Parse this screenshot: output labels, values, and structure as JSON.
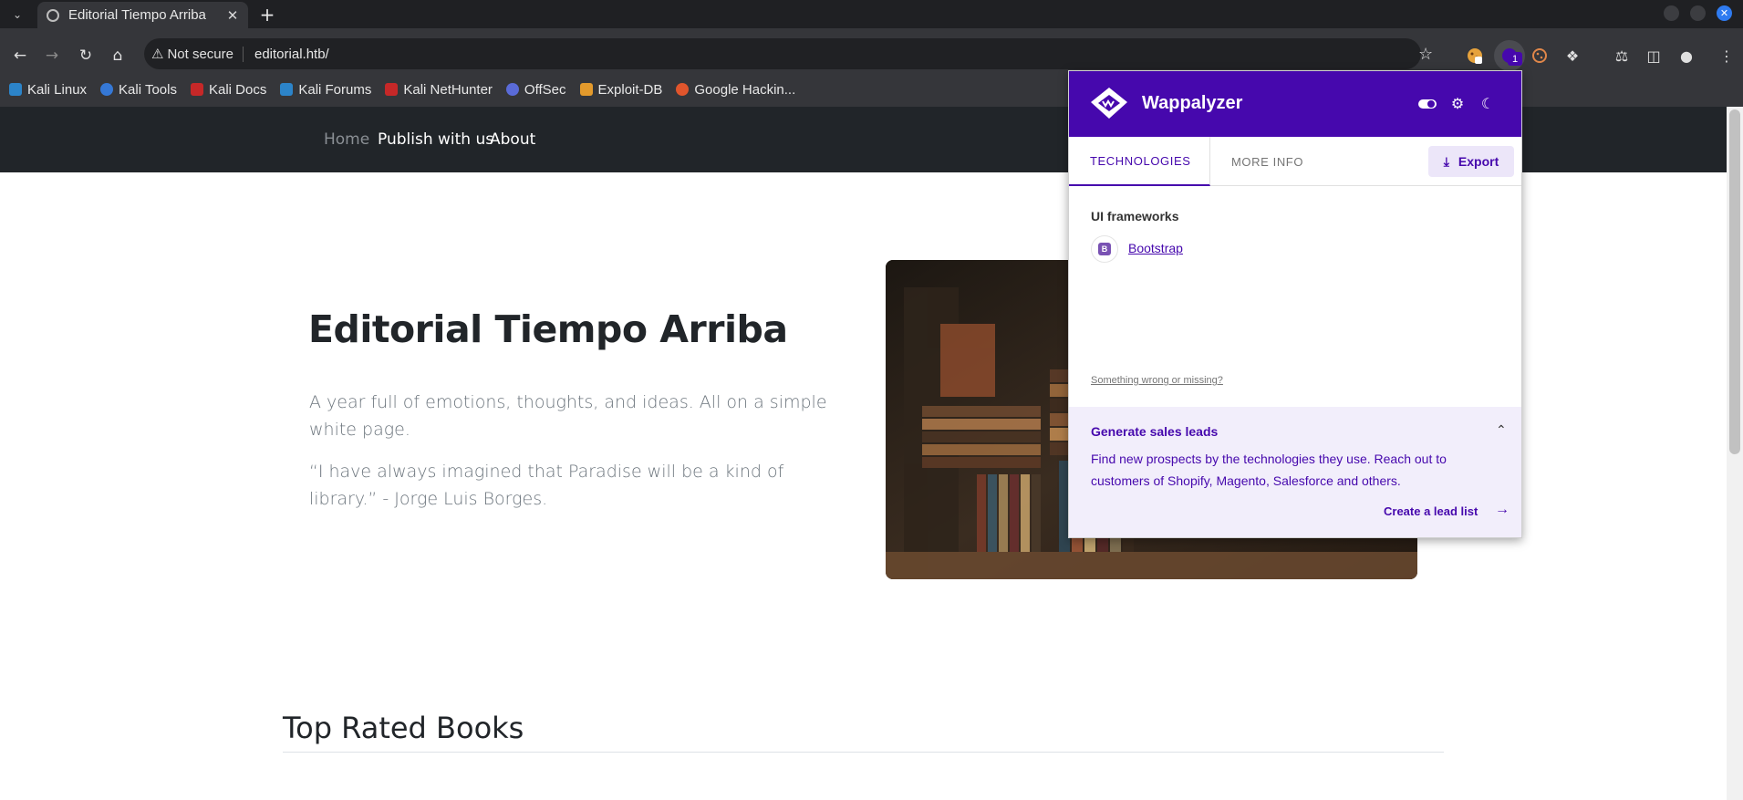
{
  "browser": {
    "tab_title": "Editorial Tiempo Arriba",
    "security_label": "Not secure",
    "url": "editorial.htb/",
    "extension_badge": "1",
    "bookmarks": [
      "Kali Linux",
      "Kali Tools",
      "Kali Docs",
      "Kali Forums",
      "Kali NetHunter",
      "OffSec",
      "Exploit-DB",
      "Google Hackin..."
    ]
  },
  "site": {
    "nav": [
      "Home",
      "Publish with us",
      "About"
    ],
    "hero_title": "Editorial Tiempo Arriba",
    "lead_1": "A year full of emotions, thoughts, and ideas. All on a simple white page.",
    "lead_2": "“I have always imagined that Paradise will be a kind of library.” - Jorge Luis Borges.",
    "section_title": "Top Rated Books"
  },
  "wappalyzer": {
    "name": "Wappalyzer",
    "tabs": [
      "TECHNOLOGIES",
      "MORE INFO"
    ],
    "export_label": "Export",
    "category": "UI frameworks",
    "tech_icon_letter": "B",
    "technology": "Bootstrap",
    "wrong_link": "Something wrong or missing?",
    "leads_title": "Generate sales leads",
    "leads_text": "Find new prospects by the technologies they use. Reach out to customers of Shopify, Magento, Salesforce and others.",
    "leads_link": "Create a lead list"
  },
  "colors": {
    "wappalyzer_purple": "#4608ad",
    "navbar": "#212529",
    "chrome_toolbar": "#35363a"
  }
}
